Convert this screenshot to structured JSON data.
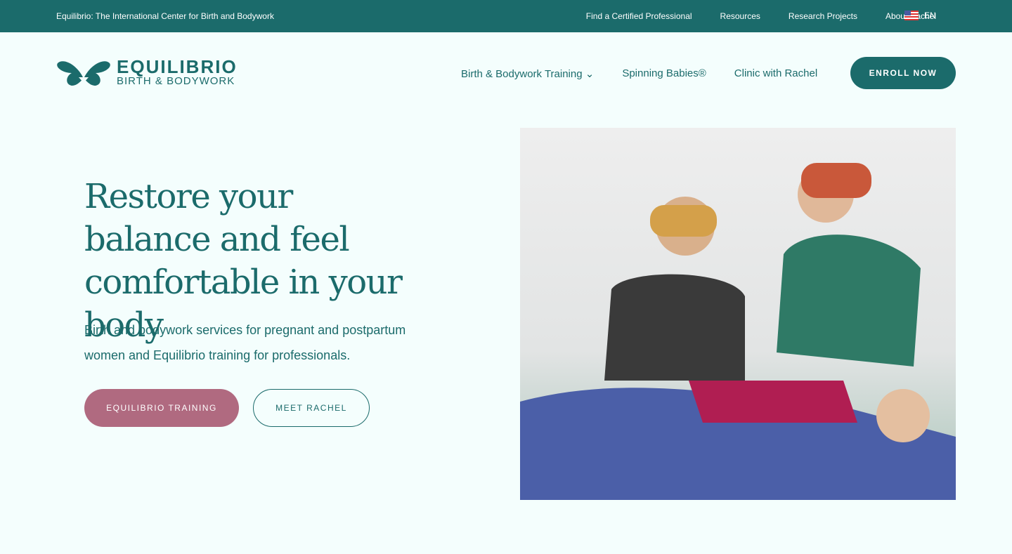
{
  "topbar": {
    "title": "Equilibrio: The International Center for Birth and Bodywork",
    "links": [
      "Find a Certified Professional",
      "Resources",
      "Research Projects",
      "About Rachel"
    ],
    "lang": "EN"
  },
  "logo": {
    "name": "EQUILIBRIO",
    "tagline": "BIRTH & BODYWORK"
  },
  "nav": {
    "items": [
      "Birth & Bodywork Training",
      "Spinning Babies®",
      "Clinic with Rachel"
    ],
    "enroll": "ENROLL NOW"
  },
  "hero": {
    "title": "Restore your balance and feel comfortable in your body",
    "subtitle": "Birth and bodywork services for pregnant and postpartum women and Equilibrio training for professionals.",
    "primary": "EQUILIBRIO TRAINING",
    "secondary": "MEET RACHEL"
  },
  "colors": {
    "brand": "#1b6b6b",
    "accent": "#b06a80",
    "background": "#f4fefd"
  }
}
